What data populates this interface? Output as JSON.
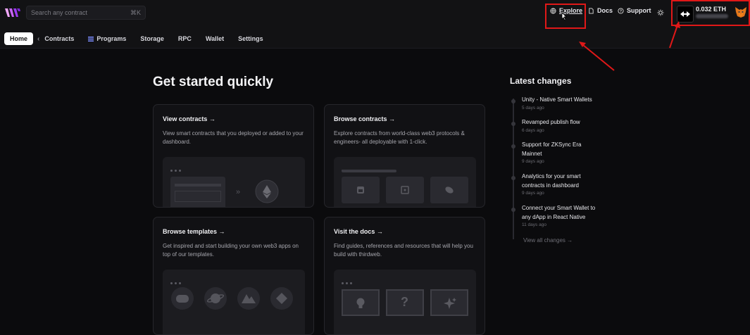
{
  "search": {
    "placeholder": "Search any contract",
    "shortcut": "⌘K"
  },
  "topnav": {
    "explore": "Explore",
    "docs": "Docs",
    "support": "Support"
  },
  "wallet": {
    "balance": "0.032 ETH"
  },
  "tabs": [
    "Home",
    "Contracts",
    "Programs",
    "Storage",
    "RPC",
    "Wallet",
    "Settings"
  ],
  "main": {
    "heading": "Get started quickly",
    "cards": [
      {
        "title": "View contracts →",
        "desc": "View smart contracts that you deployed or added to your dashboard."
      },
      {
        "title": "Browse contracts →",
        "desc": "Explore contracts from world-class web3 protocols & engineers- all deployable with 1-click."
      },
      {
        "title": "Browse templates →",
        "desc": "Get inspired and start building your own web3 apps on top of our templates."
      },
      {
        "title": "Visit the docs →",
        "desc": "Find guides, references and resources that will help you build with thirdweb."
      }
    ]
  },
  "changes": {
    "title": "Latest changes",
    "items": [
      {
        "title": "Unity - Native Smart Wallets",
        "date": "5 days ago"
      },
      {
        "title": "Revamped publish flow",
        "date": "6 days ago"
      },
      {
        "title": "Support for ZKSync Era Mainnet",
        "date": "9 days ago"
      },
      {
        "title": "Analytics for your smart contracts in dashboard",
        "date": "9 days ago"
      },
      {
        "title": "Connect your Smart Wallet to any dApp in React Native",
        "date": "11 days ago"
      }
    ],
    "view_all": "View all changes →"
  },
  "colors": {
    "highlight": "#e01818",
    "background": "#0b0b0d",
    "card": "#111114"
  }
}
